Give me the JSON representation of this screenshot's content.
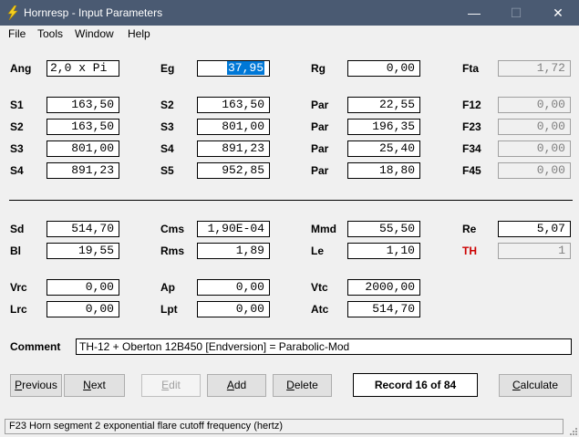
{
  "window": {
    "title": "Hornresp - Input Parameters",
    "minimize": "—",
    "maximize": "☐",
    "close": "✕"
  },
  "menu": [
    "File",
    "Tools",
    "Window",
    "Help"
  ],
  "params": {
    "Ang": "2,0 x Pi",
    "Eg": "37,95",
    "Rg": "0,00",
    "Fta": "1,72",
    "S1a": "163,50",
    "S2a": "163,50",
    "Par1": "22,55",
    "F12": "0,00",
    "S2b": "163,50",
    "S3a": "801,00",
    "Par2": "196,35",
    "F23": "0,00",
    "S3b": "801,00",
    "S4a": "891,23",
    "Par3": "25,40",
    "F34": "0,00",
    "S4b": "891,23",
    "S5": "952,85",
    "Par4": "18,80",
    "F45": "0,00",
    "Sd": "514,70",
    "Cms": "1,90E-04",
    "Mmd": "55,50",
    "Re": "5,07",
    "Bl": "19,55",
    "Rms": "1,89",
    "Le": "1,10",
    "TH": "1",
    "Vrc": "0,00",
    "Ap": "0,00",
    "Vtc": "2000,00",
    "Lrc": "0,00",
    "Lpt": "0,00",
    "Atc": "514,70"
  },
  "labels": {
    "Ang": "Ang",
    "Eg": "Eg",
    "Rg": "Rg",
    "Fta": "Fta",
    "S1": "S1",
    "S2": "S2",
    "S3": "S3",
    "S4": "S4",
    "S5": "S5",
    "Par": "Par",
    "F12": "F12",
    "F23": "F23",
    "F34": "F34",
    "F45": "F45",
    "Sd": "Sd",
    "Cms": "Cms",
    "Mmd": "Mmd",
    "Re": "Re",
    "Bl": "Bl",
    "Rms": "Rms",
    "Le": "Le",
    "TH": "TH",
    "Vrc": "Vrc",
    "Ap": "Ap",
    "Vtc": "Vtc",
    "Lrc": "Lrc",
    "Lpt": "Lpt",
    "Atc": "Atc",
    "Comment": "Comment"
  },
  "comment": "TH-12 + Oberton 12B450 [Endversion] = Parabolic-Mod",
  "buttons": {
    "previous": {
      "pre": "",
      "u": "P",
      "post": "revious"
    },
    "next": {
      "pre": "",
      "u": "N",
      "post": "ext"
    },
    "edit": {
      "pre": "",
      "u": "E",
      "post": "dit"
    },
    "add": {
      "pre": "",
      "u": "A",
      "post": "dd"
    },
    "delete": {
      "pre": "",
      "u": "D",
      "post": "elete"
    },
    "calculate": {
      "pre": "",
      "u": "C",
      "post": "alculate"
    }
  },
  "record": "Record 16 of 84",
  "status": "F23  Horn segment 2 exponential flare cutoff frequency  (hertz)",
  "colors": {
    "titlebar": "#4a5a72",
    "selection": "#0078d7",
    "th_label": "#cc0000"
  },
  "icons": {
    "app": "lightning-bolt-icon"
  }
}
